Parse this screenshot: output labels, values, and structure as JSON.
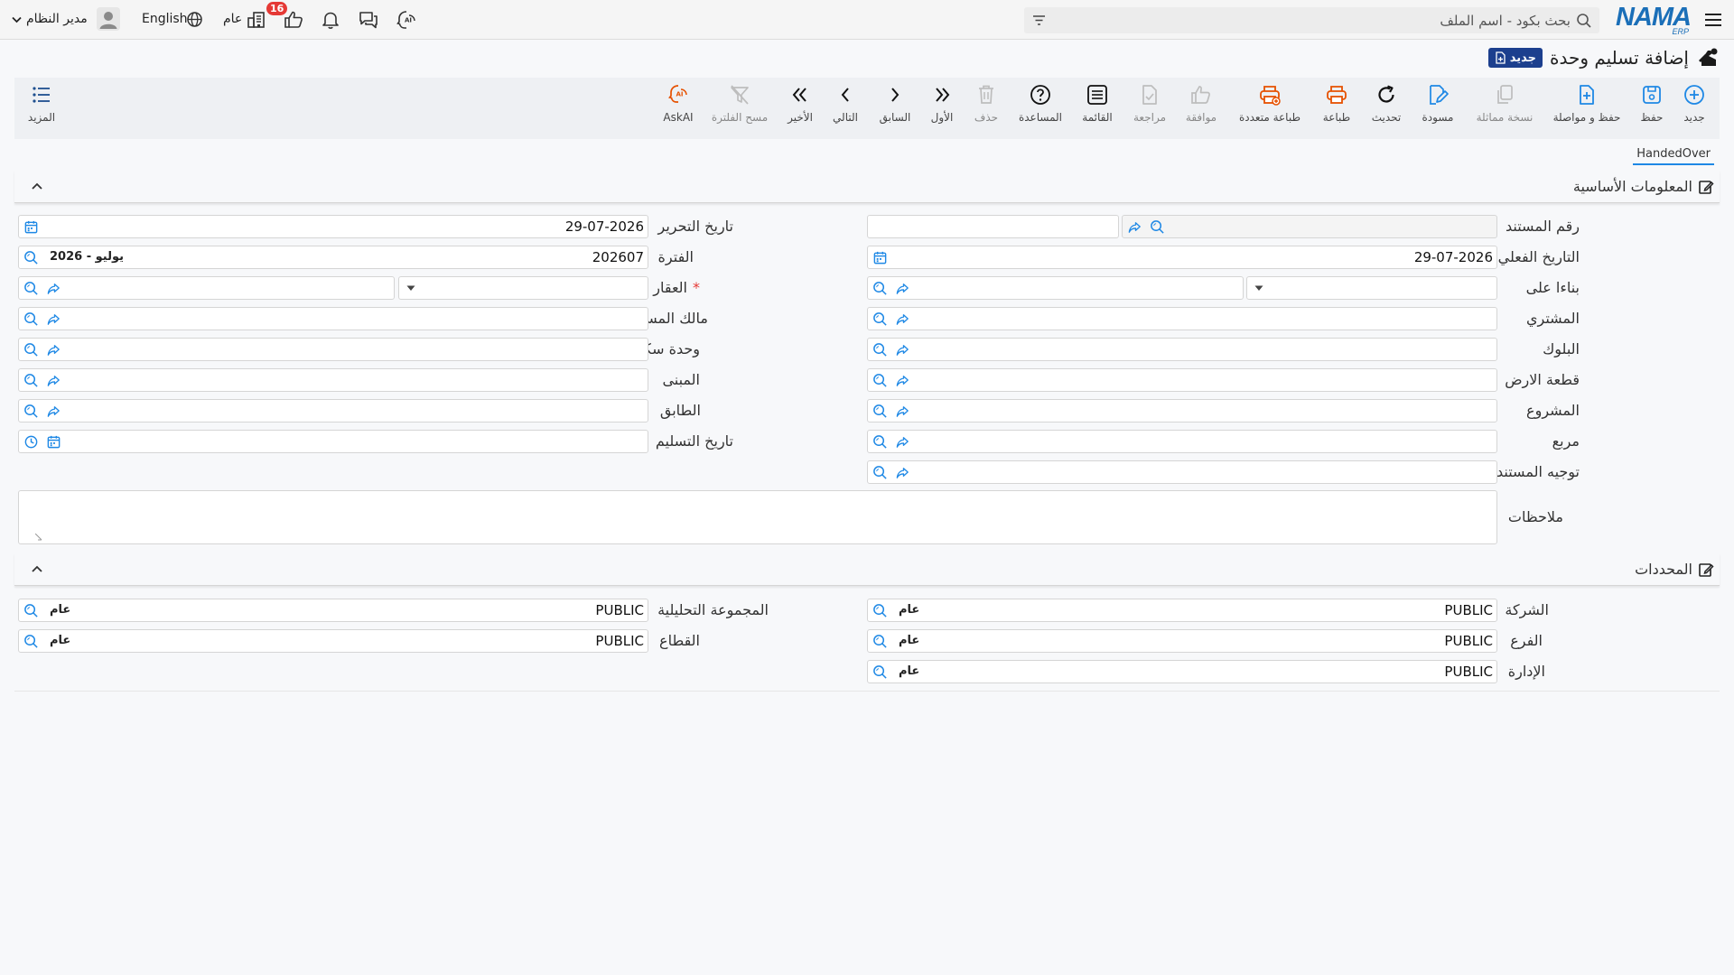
{
  "topbar": {
    "search_placeholder": "بحث بكود - اسم الملف",
    "badge_count": "16",
    "scope_label": "عام",
    "language_label": "English",
    "user_name": "مدير النظام"
  },
  "page": {
    "title": "إضافة تسليم وحدة",
    "new_badge": "جديد"
  },
  "toolbar": {
    "new": "جديد",
    "save": "حفظ",
    "save_continue": "حفظ و مواصلة",
    "duplicate": "نسخة مماثلة",
    "draft": "مسودة",
    "refresh": "تحديث",
    "print": "طباعة",
    "multi_print": "طباعة متعددة",
    "approve": "موافقة",
    "review": "مراجعة",
    "list": "القائمة",
    "help": "المساعدة",
    "delete": "حذف",
    "first": "الأول",
    "previous": "السابق",
    "next": "التالي",
    "last": "الأخير",
    "clear_filter": "مسح الفلترة",
    "askai": "AskAI",
    "more": "المزيد"
  },
  "tabs": {
    "handed_over": "HandedOver"
  },
  "basic_info": {
    "title": "المعلومات الأساسية",
    "labels": {
      "doc_number": "رقم المستند",
      "actual_date": "التاريخ الفعلي",
      "based_on": "بناءا على",
      "buyer": "المشتري",
      "block": "البلوك",
      "land_plot": "قطعة الارض",
      "project": "المشروع",
      "square": "مربع",
      "doc_direction": "توجيه المستند",
      "notes": "ملاحظات",
      "edit_date": "تاريخ التحرير",
      "period": "الفترة",
      "property": "العقار",
      "doc_owner": "مالك المستند",
      "residential_unit": "وحدة سكنية",
      "building": "المبنى",
      "floor": "الطابق",
      "delivery_date": "تاريخ التسليم"
    },
    "values": {
      "actual_date": "29-07-2026",
      "edit_date": "29-07-2026",
      "period_code": "202607",
      "period_name": "2026 - يوليو"
    }
  },
  "dimensions": {
    "title": "المحددات",
    "labels": {
      "company": "الشركة",
      "branch": "الفرع",
      "department": "الإدارة",
      "analytic_group": "المجموعة التحليلية",
      "sector": "القطاع"
    },
    "values": {
      "company_code": "PUBLIC",
      "company_name": "عام",
      "branch_code": "PUBLIC",
      "branch_name": "عام",
      "department_code": "PUBLIC",
      "department_name": "عام",
      "analytic_group_code": "PUBLIC",
      "analytic_group_name": "عام",
      "sector_code": "PUBLIC",
      "sector_name": "عام"
    }
  }
}
